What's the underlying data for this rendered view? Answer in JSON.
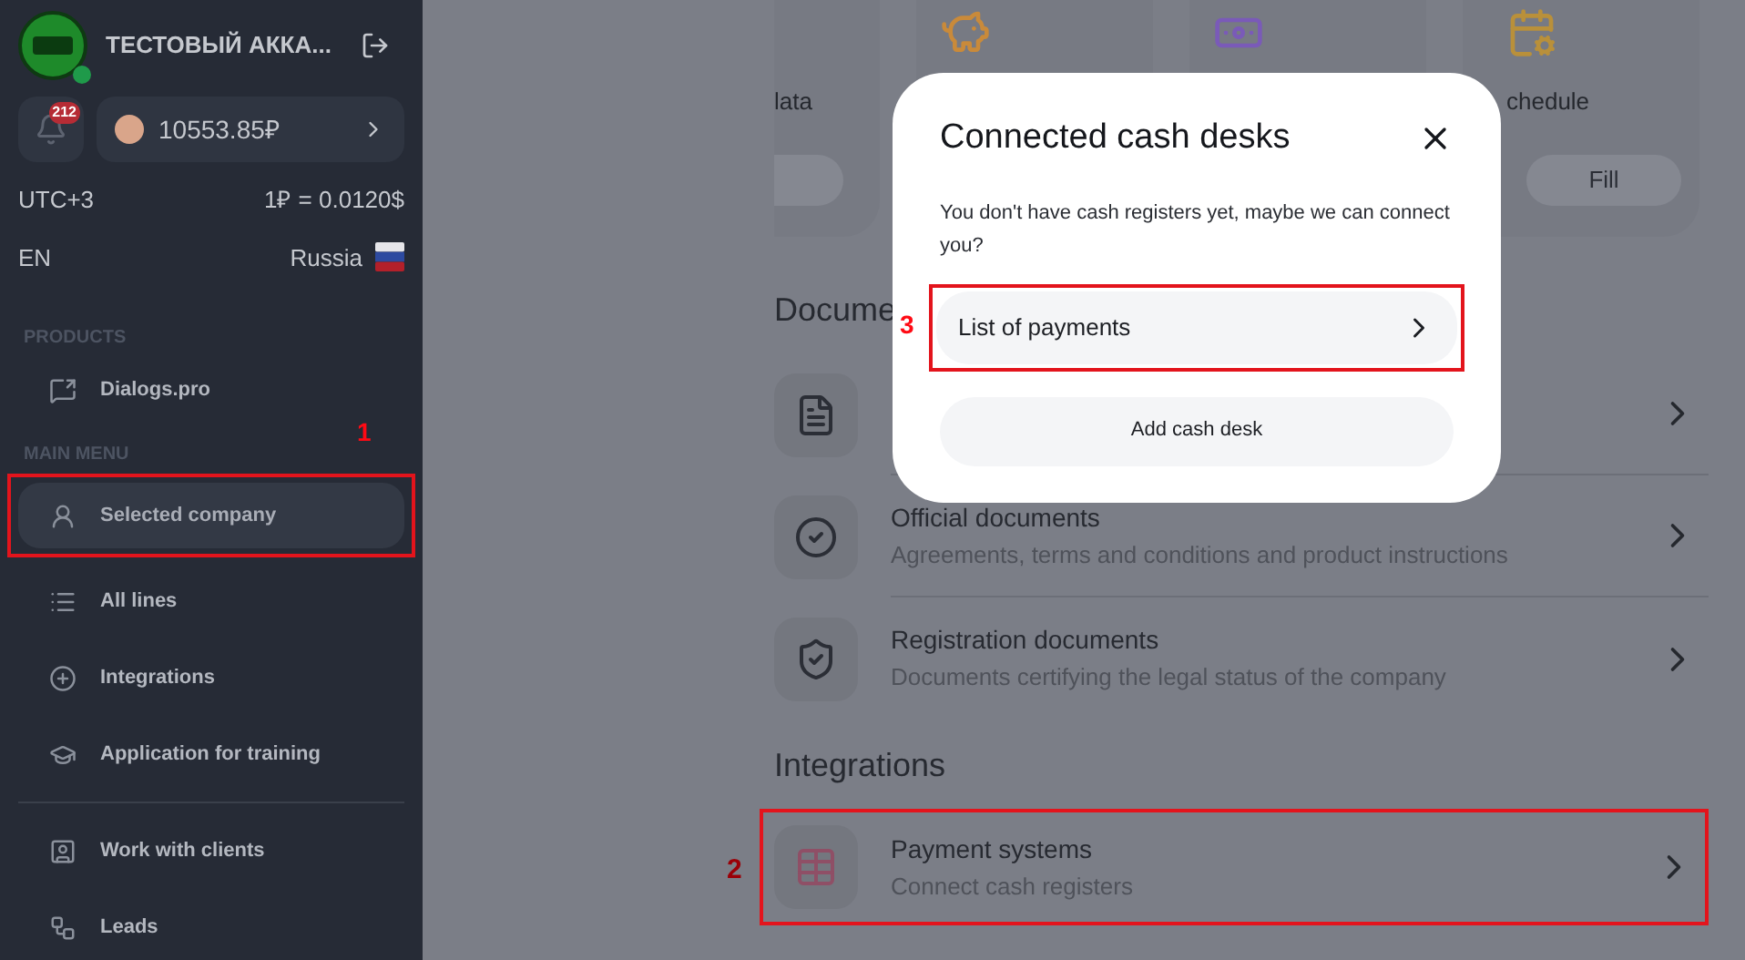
{
  "sidebar": {
    "account": {
      "name": "ТЕСТОВЫЙ АККА...",
      "online": true,
      "notifications": "212",
      "balance": "10553.85₽",
      "timezone": "UTC+3",
      "rate": "1₽ = 0.0120$",
      "language": "EN",
      "country": "Russia"
    },
    "items": [
      {
        "kind": "header",
        "label": "PRODUCTS"
      },
      {
        "kind": "item",
        "label": "Dialogs.pro",
        "selected": false
      },
      {
        "kind": "header",
        "label": "MAIN MENU",
        "marker": "1"
      },
      {
        "kind": "item",
        "label": "Selected company",
        "selected": true,
        "highlighted": true
      },
      {
        "kind": "item",
        "label": "All lines",
        "selected": false
      },
      {
        "kind": "item",
        "label": "Integrations",
        "selected": false
      },
      {
        "kind": "item",
        "label": "Application for training",
        "selected": false
      },
      {
        "kind": "divider"
      },
      {
        "kind": "item",
        "label": "Work with clients",
        "selected": false
      },
      {
        "kind": "item",
        "label": "Leads",
        "selected": false
      }
    ]
  },
  "cards": [
    {
      "kind": "data",
      "label": "lata",
      "button_shown": true
    },
    {
      "kind": "savings"
    },
    {
      "kind": "cash"
    },
    {
      "kind": "schedule",
      "label": "chedule",
      "button_shown": true,
      "button": "Fill"
    }
  ],
  "documents": {
    "heading": "Docume",
    "rows": [
      {
        "kind": "file"
      },
      {
        "kind": "check",
        "title": "Official documents",
        "subtitle": "Agreements, terms and conditions and product instructions"
      },
      {
        "kind": "shield",
        "title": "Registration documents",
        "subtitle": "Documents certifying the legal status of the company"
      }
    ]
  },
  "integrations": {
    "heading": "Integrations",
    "rows": [
      {
        "kind": "table",
        "title": "Payment systems",
        "subtitle": "Connect cash registers",
        "highlighted": true,
        "marker": "2"
      }
    ]
  },
  "modal": {
    "title": "Connected cash desks",
    "message": "You don't have cash registers yet, maybe we can connect you?",
    "options": [
      {
        "kind": "link",
        "label": "List of payments",
        "highlighted": true,
        "marker": "3"
      },
      {
        "kind": "button",
        "label": "Add cash desk",
        "highlighted": false
      }
    ]
  }
}
